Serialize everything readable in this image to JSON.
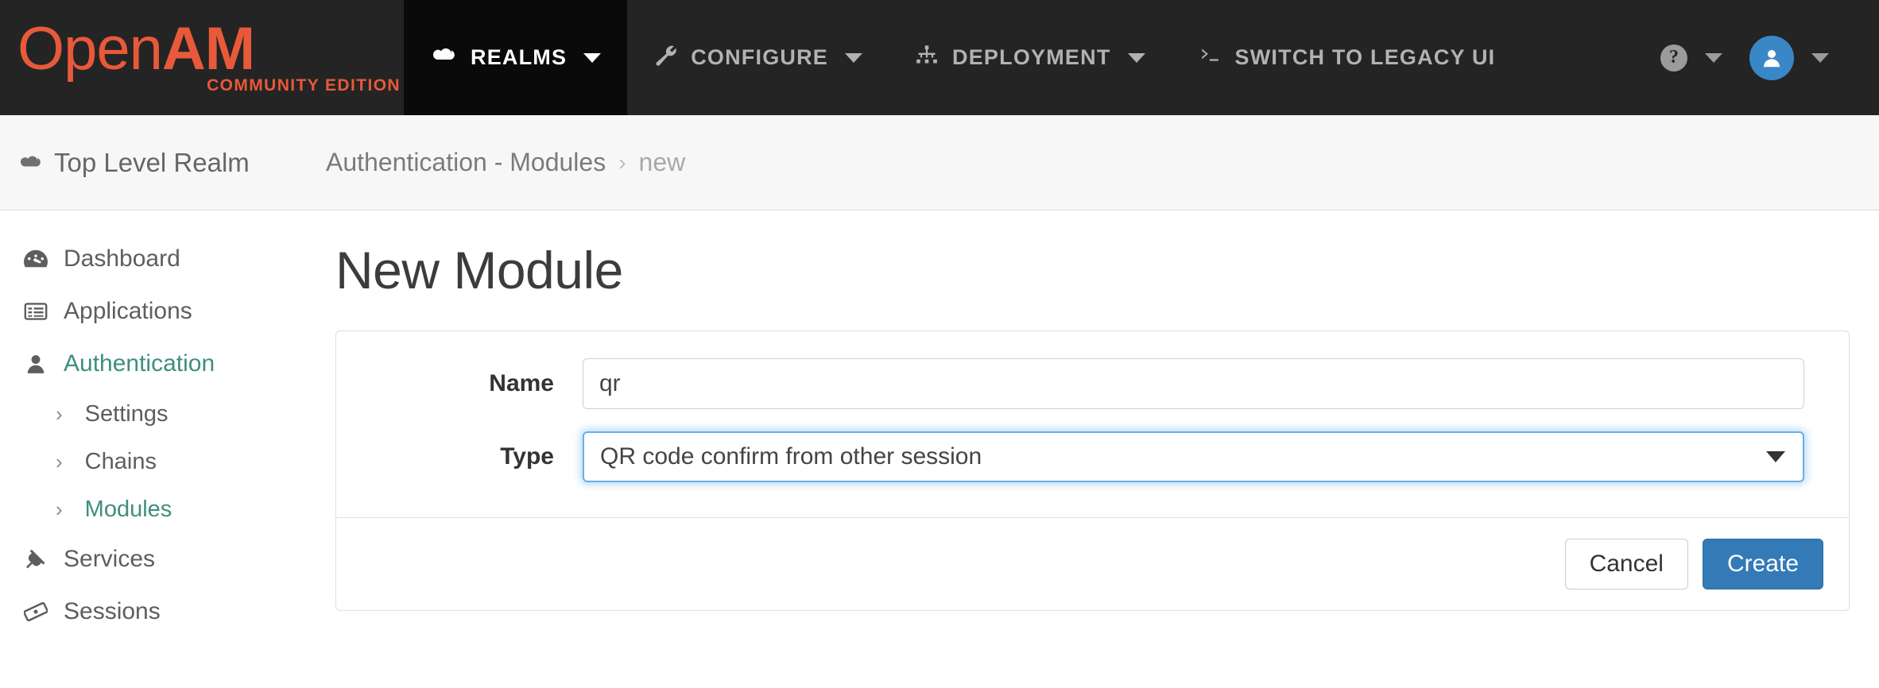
{
  "brand": {
    "word_open": "Open",
    "word_am": "AM",
    "subtitle": "COMMUNITY EDITION"
  },
  "navbar": {
    "items": [
      {
        "label": "REALMS",
        "icon": "cloud-icon",
        "active": true,
        "has_caret": true
      },
      {
        "label": "CONFIGURE",
        "icon": "wrench-icon",
        "active": false,
        "has_caret": true
      },
      {
        "label": "DEPLOYMENT",
        "icon": "sitemap-icon",
        "active": false,
        "has_caret": true
      },
      {
        "label": "SWITCH TO LEGACY UI",
        "icon": "terminal-icon",
        "active": false,
        "has_caret": false
      }
    ],
    "help": {
      "glyph": "?",
      "icon": "help-circle-icon"
    },
    "user": {
      "icon": "user-avatar-icon",
      "avatar_color": "#3a87c8"
    }
  },
  "breadcrumb": {
    "realm": "Top Level Realm",
    "realm_icon": "cloud-icon",
    "parent": "Authentication - Modules",
    "separator": "›",
    "current": "new"
  },
  "sidebar": {
    "items": [
      {
        "label": "Dashboard",
        "icon": "dashboard-icon",
        "active": false
      },
      {
        "label": "Applications",
        "icon": "list-alt-icon",
        "active": false
      },
      {
        "label": "Authentication",
        "icon": "user-icon",
        "active": true
      },
      {
        "label": "Services",
        "icon": "plug-icon",
        "active": false
      },
      {
        "label": "Sessions",
        "icon": "ticket-icon",
        "active": false
      }
    ],
    "auth_children": [
      {
        "label": "Settings",
        "active": false
      },
      {
        "label": "Chains",
        "active": false
      },
      {
        "label": "Modules",
        "active": true
      }
    ]
  },
  "main": {
    "title": "New Module",
    "form": {
      "name_label": "Name",
      "name_value": "qr",
      "name_placeholder": "",
      "type_label": "Type",
      "type_value": "QR code confirm from other session"
    },
    "footer": {
      "cancel_label": "Cancel",
      "create_label": "Create"
    }
  },
  "colors": {
    "brand_orange": "#e8593a",
    "accent_green": "#3e8e7e",
    "primary_blue": "#337ab7",
    "focus_blue": "#66afe9",
    "navbar_bg": "#242424",
    "navbar_active_bg": "#0a0a0a"
  }
}
